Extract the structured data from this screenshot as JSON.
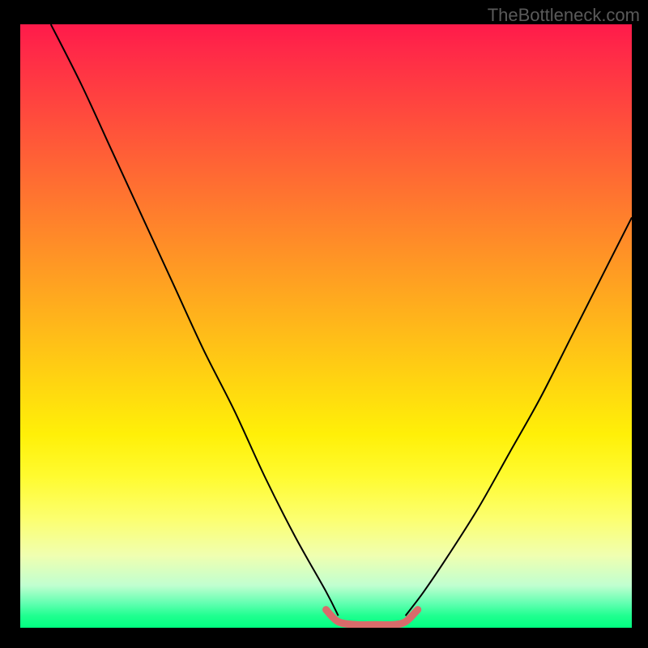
{
  "watermark": "TheBottleneck.com",
  "chart_data": {
    "type": "line",
    "title": "",
    "xlabel": "",
    "ylabel": "",
    "xlim": [
      0,
      100
    ],
    "ylim": [
      0,
      100
    ],
    "background_gradient": {
      "top_color": "#ff1a4a",
      "bottom_color": "#00ff80",
      "description": "vertical gradient red (high bottleneck) to green (optimal)"
    },
    "series": [
      {
        "name": "left-curve",
        "color": "#000000",
        "x": [
          5,
          10,
          15,
          20,
          25,
          30,
          35,
          40,
          45,
          50,
          52
        ],
        "y": [
          100,
          90,
          79,
          68,
          57,
          46,
          36,
          25,
          15,
          6,
          2
        ]
      },
      {
        "name": "valley-flat",
        "color": "#d96b6b",
        "stroke_width_heavy": true,
        "x": [
          50,
          52,
          55,
          58,
          61,
          63,
          65
        ],
        "y": [
          3,
          1,
          0.5,
          0.5,
          0.5,
          1,
          3
        ]
      },
      {
        "name": "right-curve",
        "color": "#000000",
        "x": [
          63,
          66,
          70,
          75,
          80,
          85,
          90,
          95,
          100
        ],
        "y": [
          2,
          6,
          12,
          20,
          29,
          38,
          48,
          58,
          68
        ]
      }
    ],
    "annotations": []
  }
}
